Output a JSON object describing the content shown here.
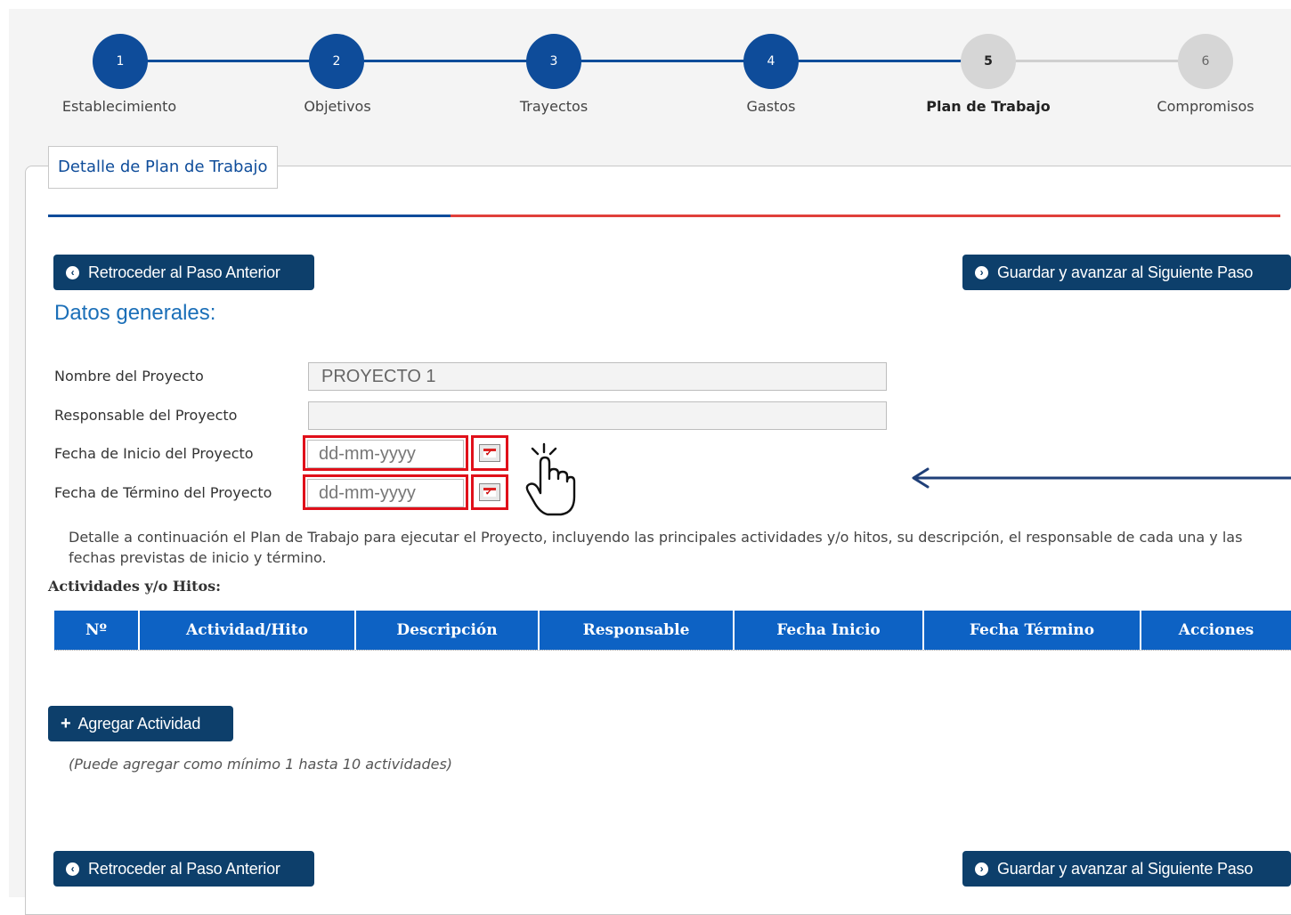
{
  "stepper": {
    "steps": [
      {
        "number": "1",
        "label": "Establecimiento",
        "state": "done"
      },
      {
        "number": "2",
        "label": "Objetivos",
        "state": "done"
      },
      {
        "number": "3",
        "label": "Trayectos",
        "state": "done"
      },
      {
        "number": "4",
        "label": "Gastos",
        "state": "done"
      },
      {
        "number": "5",
        "label": "Plan de Trabajo",
        "state": "current"
      },
      {
        "number": "6",
        "label": "Compromisos",
        "state": "pending"
      }
    ]
  },
  "panel": {
    "legend": "Detalle de Plan de Trabajo"
  },
  "nav": {
    "back_label": "Retroceder al Paso Anterior",
    "next_label": "Guardar y avanzar al Siguiente Paso"
  },
  "general": {
    "title": "Datos generales:",
    "project_name_label": "Nombre del Proyecto",
    "project_name_value": "PROYECTO 1",
    "responsible_label": "Responsable del Proyecto",
    "responsible_value": "",
    "start_date_label": "Fecha de Inicio del Proyecto",
    "start_date_placeholder": "dd-mm-yyyy",
    "end_date_label": "Fecha de Término del Proyecto",
    "end_date_placeholder": "dd-mm-yyyy"
  },
  "instructions": "Detalle a continuación el Plan de Trabajo para ejecutar el Proyecto, incluyendo las principales actividades y/o hitos, su descripción, el responsable de cada una y las fechas previstas de inicio y término.",
  "activities": {
    "heading": "Actividades y/o Hitos:",
    "columns": [
      "Nº",
      "Actividad/Hito",
      "Descripción",
      "Responsable",
      "Fecha Inicio",
      "Fecha Término",
      "Acciones"
    ],
    "add_label": "Agregar Actividad",
    "note": "(Puede agregar como mínimo 1 hasta 10 actividades)"
  },
  "colors": {
    "primary": "#0e4c9a",
    "button": "#0d3f6b",
    "table_header": "#0d62c4",
    "highlight": "#e0101a",
    "accent_red": "#e0403a"
  }
}
